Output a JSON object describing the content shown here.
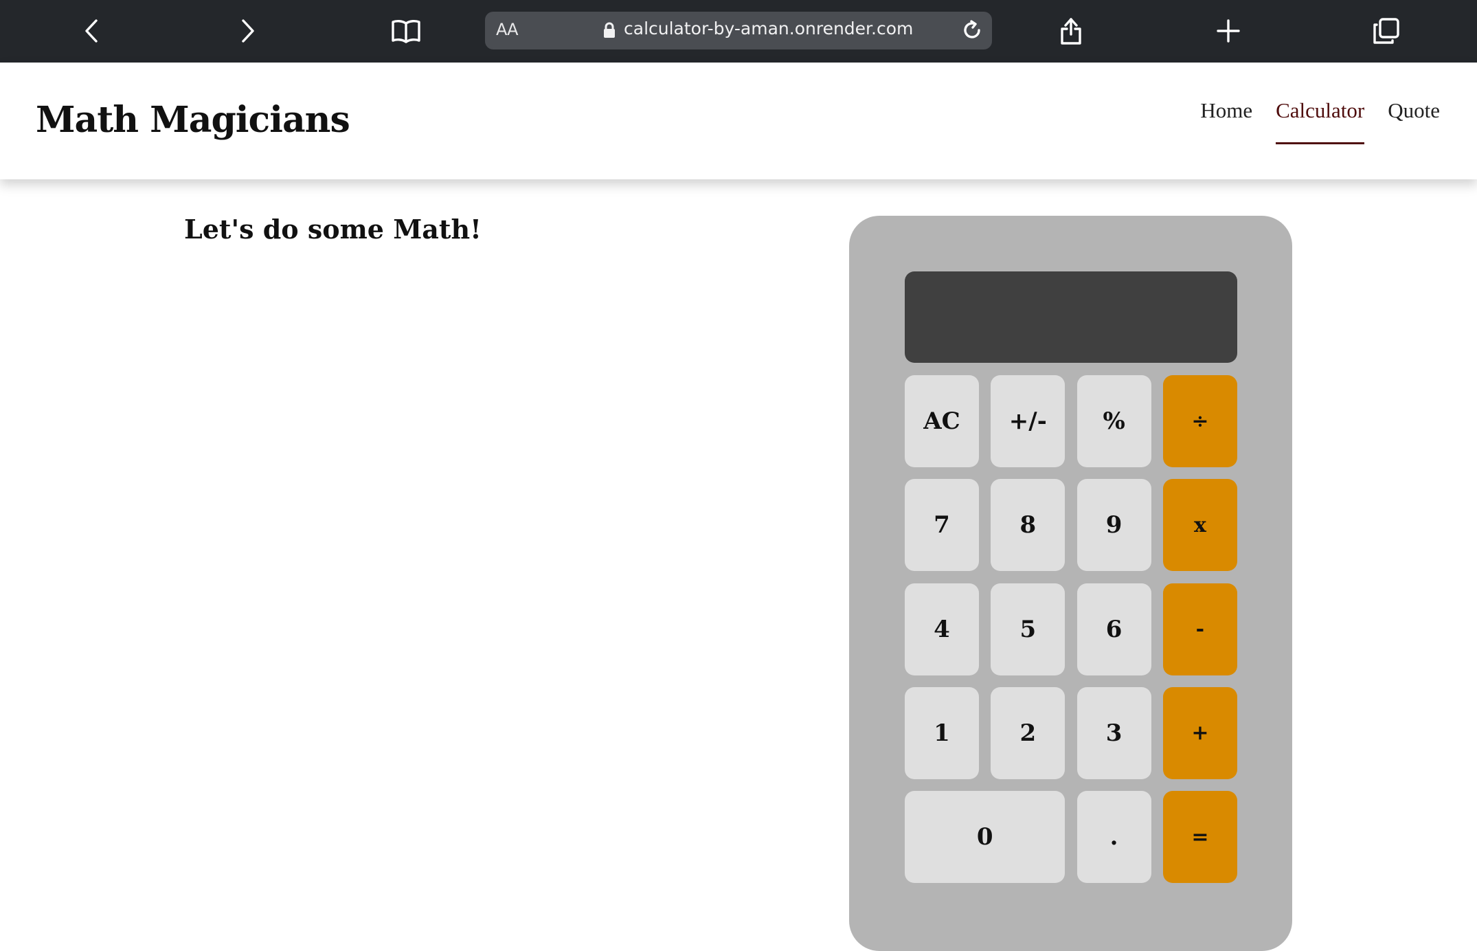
{
  "browser": {
    "aa_label": "AA",
    "url": "calculator-by-aman.onrender.com"
  },
  "site": {
    "title": "Math Magicians",
    "nav": [
      {
        "label": "Home",
        "active": false
      },
      {
        "label": "Calculator",
        "active": true
      },
      {
        "label": "Quote",
        "active": false
      }
    ]
  },
  "page": {
    "heading": "Let's do some Math!"
  },
  "calculator": {
    "display": "",
    "keys": {
      "ac": "AC",
      "sign": "+/-",
      "percent": "%",
      "divide": "÷",
      "seven": "7",
      "eight": "8",
      "nine": "9",
      "multiply": "x",
      "four": "4",
      "five": "5",
      "six": "6",
      "minus": "-",
      "one": "1",
      "two": "2",
      "three": "3",
      "plus": "+",
      "zero": "0",
      "dot": ".",
      "equals": "="
    },
    "colors": {
      "operator": "#d98a00",
      "key": "#dfdfdf",
      "body": "#b4b4b4",
      "display": "#404040"
    }
  }
}
